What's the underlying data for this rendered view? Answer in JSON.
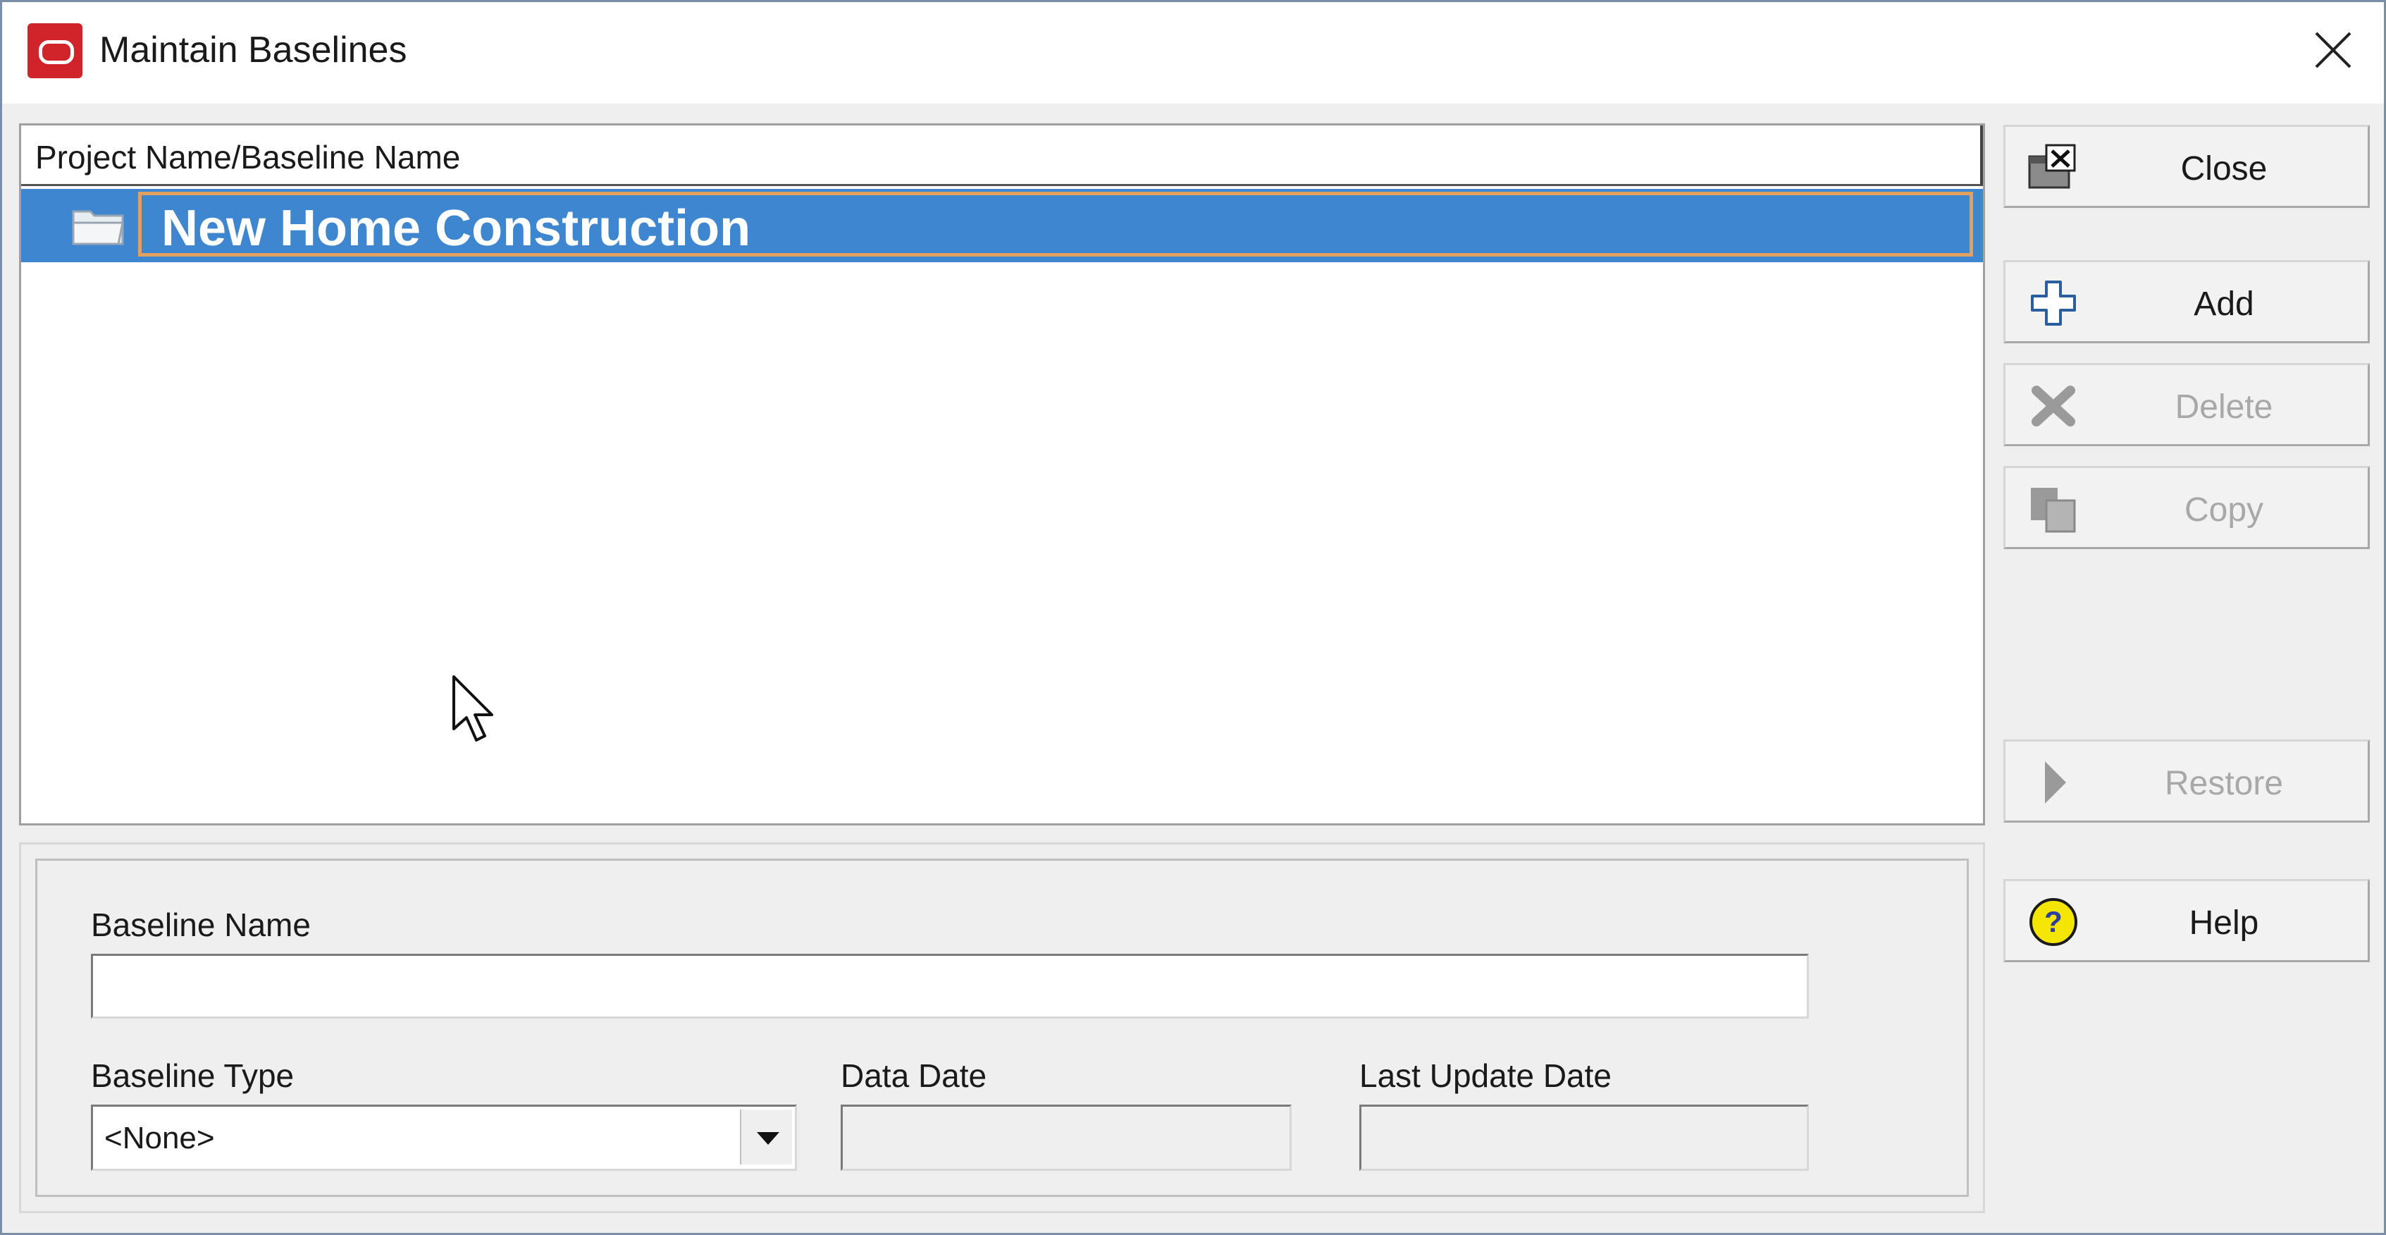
{
  "window": {
    "title": "Maintain Baselines",
    "icon": "oracle-logo-icon"
  },
  "list": {
    "column_header": "Project Name/Baseline Name",
    "rows": [
      {
        "label": "New Home Construction",
        "icon": "folder-open-icon",
        "selected": true
      }
    ]
  },
  "details": {
    "baseline_name_label": "Baseline Name",
    "baseline_name_value": "",
    "baseline_type_label": "Baseline Type",
    "baseline_type_value": "<None>",
    "data_date_label": "Data Date",
    "data_date_value": "",
    "last_update_label": "Last Update Date",
    "last_update_value": ""
  },
  "buttons": {
    "close": "Close",
    "add": "Add",
    "delete": "Delete",
    "copy": "Copy",
    "restore": "Restore",
    "help": "Help"
  },
  "colors": {
    "selection": "#3f86d0",
    "focus_border": "#e0a060",
    "disabled_text": "#a8a8a8"
  }
}
